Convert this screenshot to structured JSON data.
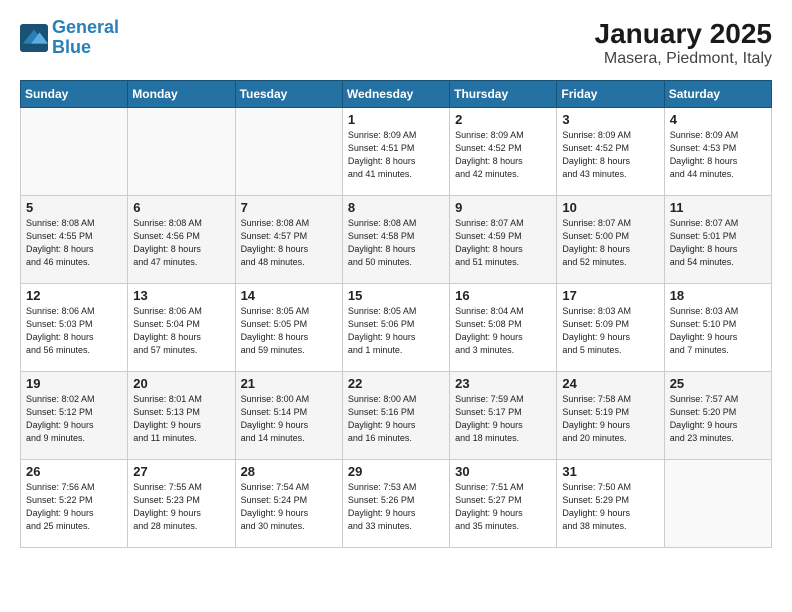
{
  "logo": {
    "line1": "General",
    "line2": "Blue"
  },
  "title": "January 2025",
  "subtitle": "Masera, Piedmont, Italy",
  "days_of_week": [
    "Sunday",
    "Monday",
    "Tuesday",
    "Wednesday",
    "Thursday",
    "Friday",
    "Saturday"
  ],
  "weeks": [
    [
      {
        "day": "",
        "info": ""
      },
      {
        "day": "",
        "info": ""
      },
      {
        "day": "",
        "info": ""
      },
      {
        "day": "1",
        "info": "Sunrise: 8:09 AM\nSunset: 4:51 PM\nDaylight: 8 hours\nand 41 minutes."
      },
      {
        "day": "2",
        "info": "Sunrise: 8:09 AM\nSunset: 4:52 PM\nDaylight: 8 hours\nand 42 minutes."
      },
      {
        "day": "3",
        "info": "Sunrise: 8:09 AM\nSunset: 4:52 PM\nDaylight: 8 hours\nand 43 minutes."
      },
      {
        "day": "4",
        "info": "Sunrise: 8:09 AM\nSunset: 4:53 PM\nDaylight: 8 hours\nand 44 minutes."
      }
    ],
    [
      {
        "day": "5",
        "info": "Sunrise: 8:08 AM\nSunset: 4:55 PM\nDaylight: 8 hours\nand 46 minutes."
      },
      {
        "day": "6",
        "info": "Sunrise: 8:08 AM\nSunset: 4:56 PM\nDaylight: 8 hours\nand 47 minutes."
      },
      {
        "day": "7",
        "info": "Sunrise: 8:08 AM\nSunset: 4:57 PM\nDaylight: 8 hours\nand 48 minutes."
      },
      {
        "day": "8",
        "info": "Sunrise: 8:08 AM\nSunset: 4:58 PM\nDaylight: 8 hours\nand 50 minutes."
      },
      {
        "day": "9",
        "info": "Sunrise: 8:07 AM\nSunset: 4:59 PM\nDaylight: 8 hours\nand 51 minutes."
      },
      {
        "day": "10",
        "info": "Sunrise: 8:07 AM\nSunset: 5:00 PM\nDaylight: 8 hours\nand 52 minutes."
      },
      {
        "day": "11",
        "info": "Sunrise: 8:07 AM\nSunset: 5:01 PM\nDaylight: 8 hours\nand 54 minutes."
      }
    ],
    [
      {
        "day": "12",
        "info": "Sunrise: 8:06 AM\nSunset: 5:03 PM\nDaylight: 8 hours\nand 56 minutes."
      },
      {
        "day": "13",
        "info": "Sunrise: 8:06 AM\nSunset: 5:04 PM\nDaylight: 8 hours\nand 57 minutes."
      },
      {
        "day": "14",
        "info": "Sunrise: 8:05 AM\nSunset: 5:05 PM\nDaylight: 8 hours\nand 59 minutes."
      },
      {
        "day": "15",
        "info": "Sunrise: 8:05 AM\nSunset: 5:06 PM\nDaylight: 9 hours\nand 1 minute."
      },
      {
        "day": "16",
        "info": "Sunrise: 8:04 AM\nSunset: 5:08 PM\nDaylight: 9 hours\nand 3 minutes."
      },
      {
        "day": "17",
        "info": "Sunrise: 8:03 AM\nSunset: 5:09 PM\nDaylight: 9 hours\nand 5 minutes."
      },
      {
        "day": "18",
        "info": "Sunrise: 8:03 AM\nSunset: 5:10 PM\nDaylight: 9 hours\nand 7 minutes."
      }
    ],
    [
      {
        "day": "19",
        "info": "Sunrise: 8:02 AM\nSunset: 5:12 PM\nDaylight: 9 hours\nand 9 minutes."
      },
      {
        "day": "20",
        "info": "Sunrise: 8:01 AM\nSunset: 5:13 PM\nDaylight: 9 hours\nand 11 minutes."
      },
      {
        "day": "21",
        "info": "Sunrise: 8:00 AM\nSunset: 5:14 PM\nDaylight: 9 hours\nand 14 minutes."
      },
      {
        "day": "22",
        "info": "Sunrise: 8:00 AM\nSunset: 5:16 PM\nDaylight: 9 hours\nand 16 minutes."
      },
      {
        "day": "23",
        "info": "Sunrise: 7:59 AM\nSunset: 5:17 PM\nDaylight: 9 hours\nand 18 minutes."
      },
      {
        "day": "24",
        "info": "Sunrise: 7:58 AM\nSunset: 5:19 PM\nDaylight: 9 hours\nand 20 minutes."
      },
      {
        "day": "25",
        "info": "Sunrise: 7:57 AM\nSunset: 5:20 PM\nDaylight: 9 hours\nand 23 minutes."
      }
    ],
    [
      {
        "day": "26",
        "info": "Sunrise: 7:56 AM\nSunset: 5:22 PM\nDaylight: 9 hours\nand 25 minutes."
      },
      {
        "day": "27",
        "info": "Sunrise: 7:55 AM\nSunset: 5:23 PM\nDaylight: 9 hours\nand 28 minutes."
      },
      {
        "day": "28",
        "info": "Sunrise: 7:54 AM\nSunset: 5:24 PM\nDaylight: 9 hours\nand 30 minutes."
      },
      {
        "day": "29",
        "info": "Sunrise: 7:53 AM\nSunset: 5:26 PM\nDaylight: 9 hours\nand 33 minutes."
      },
      {
        "day": "30",
        "info": "Sunrise: 7:51 AM\nSunset: 5:27 PM\nDaylight: 9 hours\nand 35 minutes."
      },
      {
        "day": "31",
        "info": "Sunrise: 7:50 AM\nSunset: 5:29 PM\nDaylight: 9 hours\nand 38 minutes."
      },
      {
        "day": "",
        "info": ""
      }
    ]
  ]
}
